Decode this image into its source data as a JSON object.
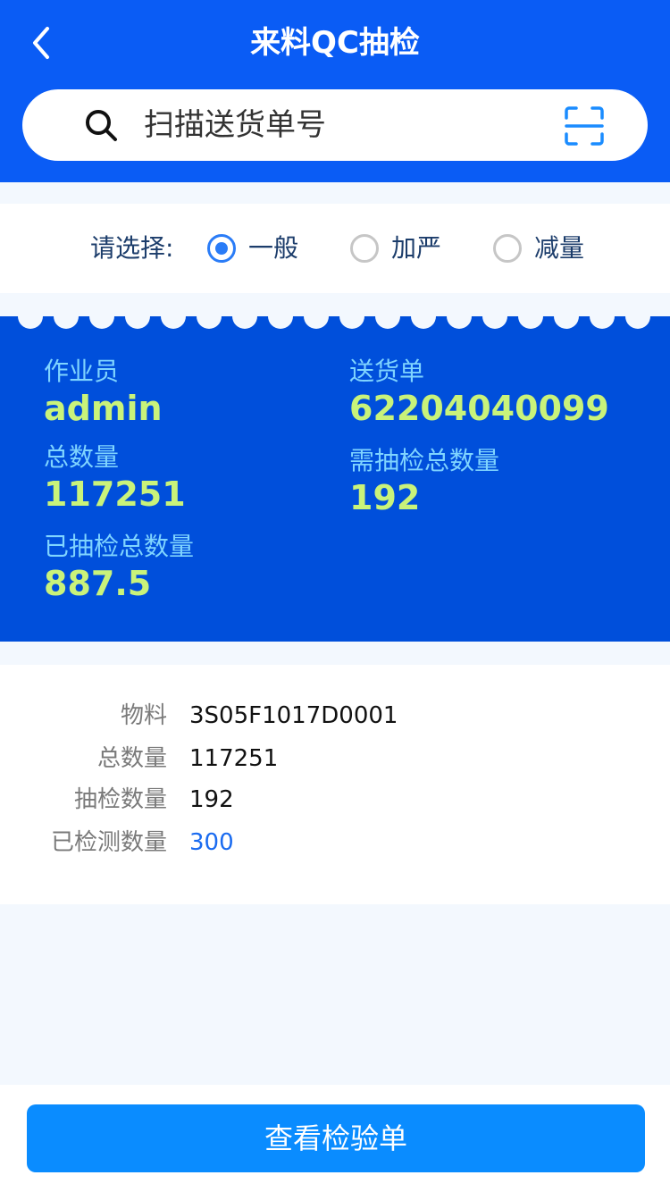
{
  "header": {
    "title": "来料QC抽检"
  },
  "search": {
    "placeholder": "扫描送货单号",
    "value": ""
  },
  "options": {
    "label": "请选择:",
    "items": [
      {
        "label": "一般",
        "checked": true
      },
      {
        "label": "加严",
        "checked": false
      },
      {
        "label": "减量",
        "checked": false
      }
    ]
  },
  "summary": {
    "operator_label": "作业员",
    "operator_value": "admin",
    "delivery_label": "送货单",
    "delivery_value": "62204040099",
    "total_label": "总数量",
    "total_value": "117251",
    "need_label": "需抽检总数量",
    "need_value": "192",
    "done_label": "已抽检总数量",
    "done_value": "887.5"
  },
  "detail": {
    "rows": [
      {
        "label": "物料",
        "value": "3S05F1017D0001"
      },
      {
        "label": "总数量",
        "value": "117251"
      },
      {
        "label": "抽检数量",
        "value": "192"
      },
      {
        "label": "已检测数量",
        "value": "300"
      }
    ]
  },
  "footer": {
    "button_label": "查看检验单"
  },
  "colors": {
    "header_bg": "#0a5cf5",
    "card_bg": "#004fdb",
    "accent_value": "#c9f37a",
    "accent_label": "#7fd4ff",
    "primary_button": "#0a8cff"
  }
}
